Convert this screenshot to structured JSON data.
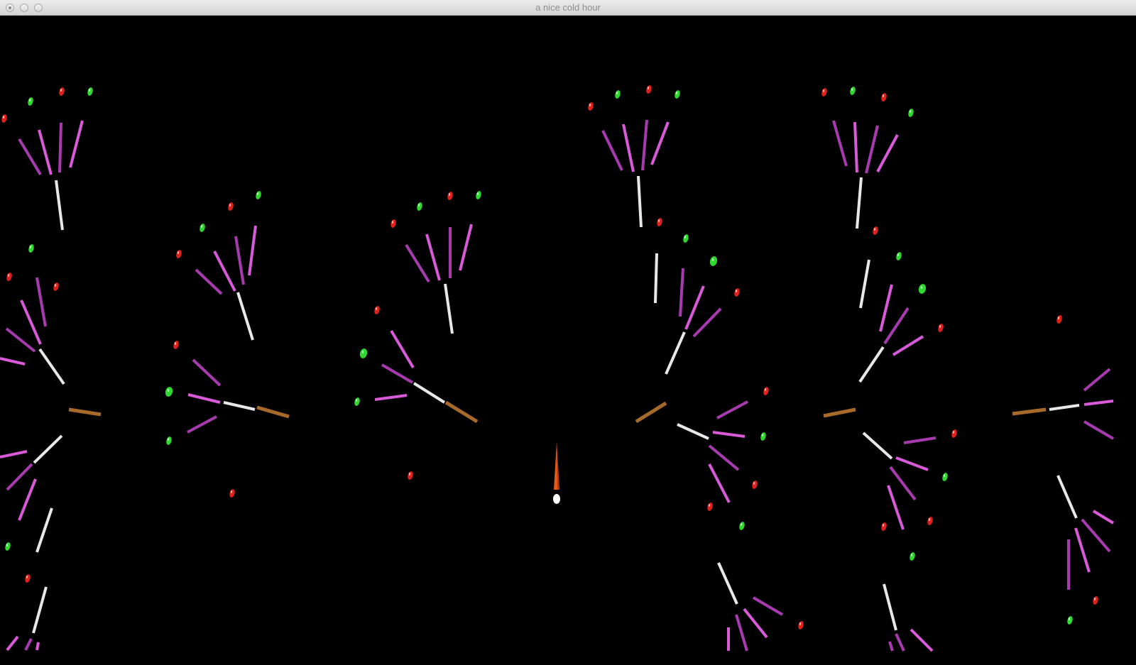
{
  "window": {
    "title": "a nice cold hour",
    "controls": [
      "close",
      "minimize",
      "zoom"
    ]
  },
  "scene": {
    "background": "#000000",
    "palette": {
      "brown": "#a86a2a",
      "white": "#e8e8e8",
      "purple": "#a83ab0",
      "magenta": "#d95ad8",
      "red": "#e0201a",
      "green": "#2fd92f",
      "ship_body": "#e85a18",
      "ship_tip": "#ffffff"
    },
    "trees": [
      {
        "trunk": "brown",
        "branch": "white"
      },
      {
        "trunk": "brown",
        "branch": "white"
      },
      {
        "trunk": "brown",
        "branch": "white"
      },
      {
        "trunk": "brown",
        "branch": "white"
      },
      {
        "trunk": "brown",
        "branch": "white"
      },
      {
        "trunk": "brown",
        "branch": "white"
      }
    ],
    "ship": {
      "name": "player-ship"
    }
  }
}
